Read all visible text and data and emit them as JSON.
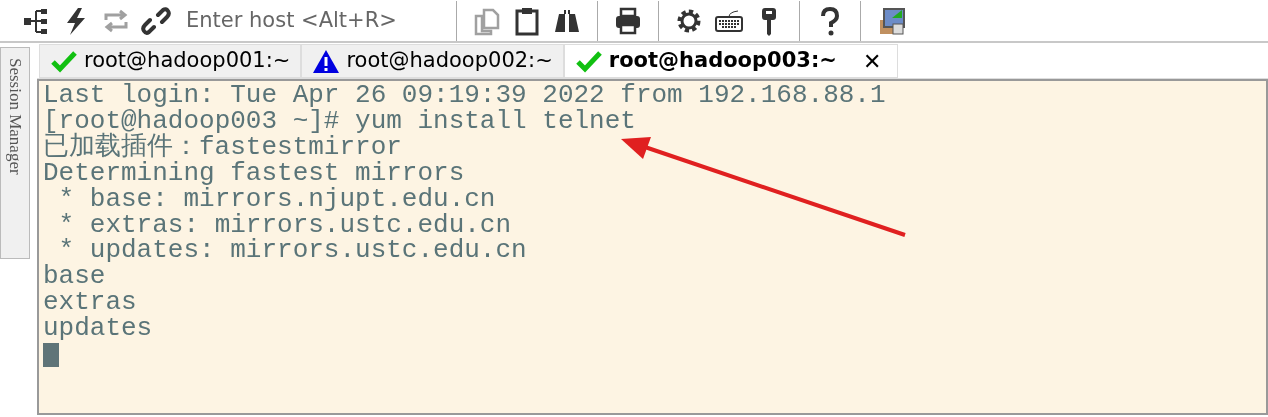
{
  "toolbar": [
    {
      "kind": "tree",
      "disabled": false
    },
    {
      "kind": "bolt",
      "disabled": false
    },
    {
      "kind": "repeat",
      "disabled": true
    },
    {
      "kind": "link",
      "disabled": false
    },
    {
      "kind": "host"
    },
    {
      "kind": "sep"
    },
    {
      "kind": "copy",
      "disabled": true
    },
    {
      "kind": "clipboard",
      "disabled": false
    },
    {
      "kind": "binoculars",
      "disabled": false
    },
    {
      "kind": "sep"
    },
    {
      "kind": "printer",
      "disabled": false
    },
    {
      "kind": "sep"
    },
    {
      "kind": "gear",
      "disabled": false
    },
    {
      "kind": "keyboard",
      "disabled": false
    },
    {
      "kind": "key",
      "disabled": false
    },
    {
      "kind": "sep"
    },
    {
      "kind": "help",
      "disabled": false
    },
    {
      "kind": "sep"
    },
    {
      "kind": "lock"
    }
  ],
  "host_field": {
    "placeholder": "Enter host <Alt+R>"
  },
  "side_panel": {
    "label": "Session Manager"
  },
  "tabs": [
    {
      "label": "root@hadoop001:~",
      "kind": "ok",
      "selected": false
    },
    {
      "label": "root@hadoop002:~",
      "kind": "warning",
      "selected": false
    },
    {
      "label": "root@hadoop003:~",
      "kind": "ok",
      "selected": true,
      "close": "✕"
    }
  ],
  "terminal": {
    "lines": [
      "Last login: Tue Apr 26 09:19:39 2022 from 192.168.88.1",
      "[root@hadoop003 ~]# yum install telnet",
      "已加载插件：fastestmirror",
      "Determining fastest mirrors",
      " * base: mirrors.njupt.edu.cn",
      " * extras: mirrors.ustc.edu.cn",
      " * updates: mirrors.ustc.edu.cn",
      "base",
      "extras",
      "updates"
    ],
    "cursor": true
  },
  "annotation": {
    "kind": "arrow"
  }
}
